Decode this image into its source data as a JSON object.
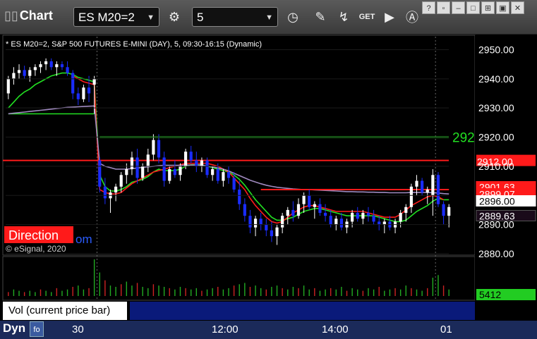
{
  "toolbar": {
    "app_title": "Chart",
    "symbol": "ES M20=2",
    "interval": "5"
  },
  "chart_header": "* ES M20=2, S&P 500 FUTURES E-MINI (DAY), 5, 09:30-16:15 (Dynamic)",
  "watermark": "© eSignal, 2020",
  "direction_label": "Direction",
  "direction_suffix": "om",
  "volume_label": "Vol (current price bar)",
  "volume_value": "5412",
  "bottom_left": "Dyn",
  "colors": {
    "up_candle": "#ffffff",
    "down_candle": "#1a2cff",
    "green_line": "#22e022",
    "red_line": "#ff1a1a",
    "purple_line": "#a08ac0",
    "volume_bar": "#cc2222"
  },
  "chart_data": {
    "type": "candlestick",
    "title": "* ES M20=2, S&P 500 FUTURES E-MINI (DAY), 5, 09:30-16:15 (Dynamic)",
    "y_ticks": [
      2880.0,
      2890.0,
      2900.0,
      2910.0,
      2920.0,
      2930.0,
      2940.0,
      2950.0
    ],
    "y_tick_labels": [
      "2880.00",
      "2890.00",
      "2900.00",
      "2910.00",
      "2920.00",
      "2930.00",
      "2940.00",
      "2950.00"
    ],
    "ylim": [
      2879.5,
      2953.5
    ],
    "x_labels": [
      "30",
      "12:00",
      "14:00",
      "01"
    ],
    "horizontal_levels": [
      {
        "price": 2920.0,
        "color": "#22e022",
        "label": "292"
      },
      {
        "price": 2912.0,
        "color": "#ff1a1a",
        "label": "2912.00"
      }
    ],
    "price_tags": [
      {
        "price": 2901.63,
        "label": "2901.63",
        "bg": "#ff1a1a",
        "fg": "#ffffff"
      },
      {
        "price": 2899.07,
        "label": "2899.07",
        "bg": "#ff1a1a",
        "fg": "#ffffff"
      },
      {
        "price": 2896.0,
        "label": "2896.00",
        "bg": "#ffffff",
        "fg": "#000000"
      },
      {
        "price": 2889.63,
        "label": "2889.63",
        "bg": "#1a0a1a",
        "fg": "#ffffff"
      }
    ],
    "candles": [
      [
        2935.0,
        2941.0,
        2933.0,
        2940.0
      ],
      [
        2940.0,
        2944.0,
        2938.0,
        2942.0
      ],
      [
        2942.0,
        2945.0,
        2940.0,
        2943.0
      ],
      [
        2943.0,
        2944.5,
        2940.0,
        2941.0
      ],
      [
        2941.0,
        2944.0,
        2939.0,
        2943.0
      ],
      [
        2943.0,
        2945.0,
        2941.0,
        2944.0
      ],
      [
        2944.0,
        2946.0,
        2942.0,
        2945.0
      ],
      [
        2945.0,
        2947.0,
        2943.0,
        2946.0
      ],
      [
        2946.0,
        2947.0,
        2943.0,
        2944.0
      ],
      [
        2944.0,
        2946.0,
        2941.0,
        2945.0
      ],
      [
        2945.0,
        2946.0,
        2943.0,
        2944.0
      ],
      [
        2944.0,
        2946.0,
        2941.0,
        2942.0
      ],
      [
        2942.0,
        2943.0,
        2933.0,
        2935.0
      ],
      [
        2935.0,
        2937.0,
        2931.0,
        2933.0
      ],
      [
        2933.0,
        2938.0,
        2932.0,
        2937.0
      ],
      [
        2937.0,
        2941.0,
        2932.0,
        2935.0
      ],
      [
        2938.0,
        2941.0,
        2928.0,
        2940.0
      ],
      [
        2912.0,
        2913.0,
        2901.0,
        2903.0
      ],
      [
        2903.0,
        2906.0,
        2897.0,
        2899.0
      ],
      [
        2899.0,
        2902.0,
        2894.0,
        2901.0
      ],
      [
        2901.0,
        2904.0,
        2898.0,
        2903.0
      ],
      [
        2903.0,
        2908.0,
        2901.0,
        2907.0
      ],
      [
        2907.0,
        2911.0,
        2904.0,
        2909.0
      ],
      [
        2909.0,
        2915.0,
        2907.0,
        2913.0
      ],
      [
        2913.0,
        2916.0,
        2904.0,
        2906.0
      ],
      [
        2906.0,
        2911.0,
        2905.0,
        2910.0
      ],
      [
        2910.0,
        2916.0,
        2908.0,
        2914.0
      ],
      [
        2914.0,
        2921.0,
        2912.0,
        2919.0
      ],
      [
        2919.0,
        2921.0,
        2911.0,
        2913.0
      ],
      [
        2913.0,
        2915.0,
        2903.0,
        2905.0
      ],
      [
        2905.0,
        2910.0,
        2904.0,
        2909.0
      ],
      [
        2909.0,
        2912.0,
        2906.0,
        2907.0
      ],
      [
        2907.0,
        2911.0,
        2905.0,
        2910.0
      ],
      [
        2910.0,
        2916.0,
        2909.0,
        2915.0
      ],
      [
        2915.0,
        2917.0,
        2911.0,
        2912.0
      ],
      [
        2912.0,
        2915.0,
        2908.0,
        2910.0
      ],
      [
        2910.0,
        2913.0,
        2908.0,
        2912.0
      ],
      [
        2912.0,
        2913.0,
        2906.0,
        2907.0
      ],
      [
        2907.0,
        2910.0,
        2905.0,
        2909.0
      ],
      [
        2909.0,
        2911.0,
        2904.0,
        2905.0
      ],
      [
        2905.0,
        2909.0,
        2903.0,
        2908.0
      ],
      [
        2908.0,
        2910.0,
        2904.0,
        2906.0
      ],
      [
        2906.0,
        2908.0,
        2901.0,
        2902.0
      ],
      [
        2902.0,
        2905.0,
        2895.0,
        2897.0
      ],
      [
        2897.0,
        2899.0,
        2891.0,
        2893.0
      ],
      [
        2893.0,
        2895.0,
        2887.0,
        2889.0
      ],
      [
        2889.0,
        2893.0,
        2886.0,
        2892.0
      ],
      [
        2892.0,
        2894.0,
        2888.0,
        2890.0
      ],
      [
        2890.0,
        2892.0,
        2886.0,
        2888.0
      ],
      [
        2888.0,
        2891.0,
        2884.0,
        2886.0
      ],
      [
        2886.0,
        2890.0,
        2883.0,
        2889.0
      ],
      [
        2889.0,
        2894.0,
        2887.0,
        2893.0
      ],
      [
        2893.0,
        2896.0,
        2890.0,
        2895.0
      ],
      [
        2895.0,
        2898.0,
        2891.0,
        2893.0
      ],
      [
        2893.0,
        2899.0,
        2892.0,
        2897.0
      ],
      [
        2897.0,
        2901.0,
        2894.0,
        2900.0
      ],
      [
        2900.0,
        2902.0,
        2895.0,
        2896.0
      ],
      [
        2896.0,
        2898.0,
        2892.0,
        2897.0
      ],
      [
        2897.0,
        2899.0,
        2893.0,
        2894.0
      ],
      [
        2894.0,
        2897.0,
        2891.0,
        2893.0
      ],
      [
        2893.0,
        2895.0,
        2889.0,
        2890.0
      ],
      [
        2890.0,
        2893.0,
        2888.0,
        2892.0
      ],
      [
        2892.0,
        2894.0,
        2888.0,
        2889.0
      ],
      [
        2889.0,
        2892.0,
        2887.0,
        2891.0
      ],
      [
        2891.0,
        2895.0,
        2889.0,
        2894.0
      ],
      [
        2894.0,
        2896.0,
        2891.0,
        2892.0
      ],
      [
        2892.0,
        2895.0,
        2890.0,
        2894.0
      ],
      [
        2894.0,
        2896.0,
        2891.0,
        2893.0
      ],
      [
        2893.0,
        2895.0,
        2890.0,
        2891.0
      ],
      [
        2891.0,
        2893.0,
        2888.0,
        2890.0
      ],
      [
        2890.0,
        2892.0,
        2887.0,
        2891.0
      ],
      [
        2891.0,
        2893.0,
        2888.0,
        2889.0
      ],
      [
        2889.0,
        2892.0,
        2887.0,
        2891.0
      ],
      [
        2891.0,
        2895.0,
        2889.0,
        2894.0
      ],
      [
        2894.0,
        2897.0,
        2891.0,
        2896.0
      ],
      [
        2896.0,
        2904.0,
        2894.0,
        2903.0
      ],
      [
        2903.0,
        2907.0,
        2900.0,
        2905.0
      ],
      [
        2905.0,
        2906.0,
        2900.0,
        2901.0
      ],
      [
        2901.0,
        2903.0,
        2897.0,
        2902.0
      ],
      [
        2900.0,
        2909.0,
        2893.0,
        2907.0
      ],
      [
        2907.0,
        2908.0,
        2896.0,
        2897.0
      ],
      [
        2897.0,
        2898.0,
        2890.0,
        2893.0
      ],
      [
        2893.0,
        2897.0,
        2889.0,
        2896.0
      ]
    ],
    "series": [
      {
        "name": "",
        "color": "#22e022",
        "values": [
          2930.0,
          2932.0,
          2934.0,
          2935.5,
          2936.5,
          2938.0,
          2939.0,
          2940.0,
          2941.0,
          2941.5,
          2942.0,
          2942.0,
          2941.5,
          2940.5,
          2940.0,
          2939.5,
          2939.0,
          2907.0,
          2903.0,
          2901.5,
          2901.5,
          2902.0,
          2903.0,
          2904.5,
          2905.0,
          2905.5,
          2906.5,
          2908.0,
          2909.0,
          2908.5,
          2908.5,
          2908.5,
          2909.0,
          2910.0,
          2910.5,
          2910.5,
          2910.5,
          2910.0,
          2909.5,
          2909.0,
          2908.5,
          2908.0,
          2907.0,
          2905.5,
          2903.5,
          2901.0,
          2898.5,
          2896.5,
          2894.5,
          2892.5,
          2891.5,
          2891.5,
          2892.0,
          2892.5,
          2893.5,
          2894.5,
          2895.0,
          2895.5,
          2895.5,
          2895.0,
          2894.5,
          2894.0,
          2893.5,
          2893.0,
          2893.0,
          2893.0,
          2893.0,
          2893.0,
          2893.0,
          2892.5,
          2892.0,
          2891.5,
          2891.0,
          2891.0,
          2891.5,
          2893.0,
          2894.5,
          2895.5,
          2896.5,
          2898.0,
          2899.0,
          2898.5,
          2898.5
        ]
      },
      {
        "name": "",
        "color": "#ff1a1a",
        "values": [
          null,
          null,
          null,
          null,
          null,
          null,
          null,
          null,
          null,
          null,
          null,
          null,
          2941.0,
          2940.0,
          2939.0,
          2938.5,
          2938.0,
          2902.0,
          2901.0,
          2900.5,
          2900.5,
          2901.0,
          2902.5,
          2904.0,
          2905.0,
          2906.0,
          2907.0,
          2908.0,
          2908.5,
          2909.0,
          2909.5,
          2910.0,
          2910.5,
          2911.0,
          2911.0,
          2911.0,
          2911.0,
          2911.0,
          2910.5,
          2910.0,
          2909.0,
          2908.0,
          2906.0,
          2904.0,
          2902.0,
          2899.0,
          2896.5,
          2894.5,
          2892.5,
          2891.0,
          2890.5,
          2891.0,
          2892.5,
          2894.0,
          2895.0,
          2896.0,
          2896.5,
          2896.5,
          2896.0,
          2895.5,
          2895.0,
          2894.5,
          2894.5,
          2894.5,
          2894.5,
          2894.5,
          2894.5,
          2894.0,
          2893.5,
          2893.0,
          2892.5,
          2892.5,
          2892.5,
          2893.5,
          2895.0,
          2896.5,
          2897.5,
          2898.5,
          2899.5,
          2900.0,
          2899.5,
          2898.5
        ]
      },
      {
        "name": "",
        "color": "#a08ac0",
        "values": [
          2928.0,
          2928.2,
          2928.4,
          2928.6,
          2928.8,
          2929.0,
          2929.2,
          2929.4,
          2929.6,
          2929.8,
          2930.0,
          2930.2,
          2930.3,
          2930.4,
          2930.5,
          2930.6,
          2930.7,
          2911.0,
          2910.0,
          2909.5,
          2909.0,
          2909.0,
          2909.0,
          2909.2,
          2909.4,
          2909.6,
          2909.8,
          2910.0,
          2910.2,
          2910.3,
          2910.3,
          2910.3,
          2910.3,
          2910.4,
          2910.4,
          2910.4,
          2910.3,
          2910.1,
          2909.8,
          2909.4,
          2909.0,
          2908.4,
          2907.6,
          2906.8,
          2906.0,
          2905.2,
          2904.6,
          2904.0,
          2903.5,
          2903.1,
          2902.8,
          2902.6,
          2902.4,
          2902.2,
          2902.1,
          2902.0,
          2902.0,
          2901.9,
          2901.8,
          2901.7,
          2901.6,
          2901.5,
          2901.4,
          2901.3,
          2901.3,
          2901.2,
          2901.2,
          2901.1,
          2901.1,
          2901.0,
          2901.0,
          2900.9,
          2900.9,
          2900.9,
          2900.9,
          2901.0,
          2901.0,
          2901.0,
          2901.0,
          2900.9,
          2900.8,
          2900.6,
          2900.5
        ]
      },
      {
        "name": "",
        "color": "#ff1a1a",
        "values": [
          null,
          null,
          null,
          null,
          null,
          null,
          null,
          null,
          null,
          null,
          null,
          null,
          null,
          null,
          null,
          null,
          null,
          null,
          null,
          null,
          null,
          null,
          null,
          null,
          null,
          null,
          null,
          null,
          null,
          null,
          null,
          null,
          null,
          null,
          null,
          null,
          null,
          null,
          null,
          null,
          null,
          null,
          null,
          null,
          null,
          null,
          null,
          2902.0,
          2902.0,
          2902.0,
          2902.0,
          2902.0,
          2902.0,
          2902.0,
          2902.0,
          2902.0,
          2902.0,
          2902.0,
          2902.0,
          2902.0,
          2902.0,
          2902.0,
          2902.0,
          2902.0,
          2902.0,
          2902.0,
          2902.0,
          2902.0,
          2902.0,
          2902.0,
          2902.0,
          2902.0,
          2902.0,
          2902.0,
          2902.0,
          2902.0,
          2902.0,
          2902.0,
          2902.0,
          2902.0,
          2902.0,
          2902.0,
          2902.0
        ]
      }
    ],
    "step_line": {
      "color": "#22e022",
      "segments": [
        [
          0,
          16,
          2926.0
        ],
        [
          17,
          82,
          2926.0
        ]
      ]
    },
    "volume": [
      3,
      5,
      4,
      3,
      4,
      3,
      5,
      4,
      3,
      6,
      4,
      5,
      7,
      8,
      5,
      6,
      28,
      18,
      12,
      8,
      7,
      9,
      11,
      8,
      10,
      7,
      6,
      9,
      8,
      7,
      6,
      5,
      7,
      6,
      5,
      6,
      4,
      5,
      6,
      7,
      5,
      6,
      8,
      9,
      10,
      7,
      8,
      6,
      5,
      7,
      8,
      6,
      5,
      7,
      6,
      8,
      5,
      6,
      4,
      5,
      6,
      5,
      7,
      4,
      6,
      5,
      4,
      6,
      5,
      7,
      4,
      5,
      6,
      5,
      8,
      6,
      5,
      4,
      6,
      14,
      16,
      8,
      5
    ]
  }
}
